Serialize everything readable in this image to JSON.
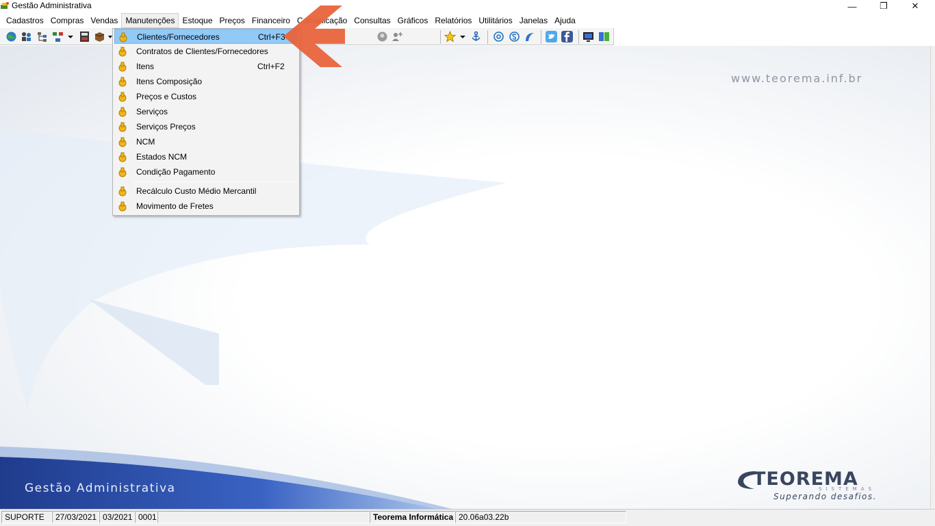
{
  "window": {
    "title": "Gestão Administrativa",
    "controls": {
      "minimize": "—",
      "restore": "❐",
      "close": "✕"
    }
  },
  "menubar": {
    "items": [
      "Cadastros",
      "Compras",
      "Vendas",
      "Manutenções",
      "Estoque",
      "Preços",
      "Financeiro",
      "Comunicação",
      "Consultas",
      "Gráficos",
      "Relatórios",
      "Utilitários",
      "Janelas",
      "Ajuda"
    ],
    "active": "Manutenções"
  },
  "toolbar": {
    "icons": [
      "globe-icon",
      "people-icon",
      "tree-icon",
      "network-icon",
      "chevron-down-icon",
      "calculator-icon",
      "box-icon",
      "chevron-down-icon",
      "user-circle-icon",
      "add-user-icon",
      "star-icon",
      "chevron-down-icon",
      "anchor-icon",
      "email-at-icon",
      "skype-icon",
      "swirl-icon",
      "twitter-icon",
      "facebook-icon",
      "monitor-icon",
      "window-tile-icon"
    ]
  },
  "dropdown": {
    "items": [
      {
        "label": "Clientes/Fornecedores",
        "shortcut": "Ctrl+F3",
        "highlighted": true
      },
      {
        "label": "Contratos de Clientes/Fornecedores",
        "shortcut": ""
      },
      {
        "label": "Itens",
        "shortcut": "Ctrl+F2"
      },
      {
        "label": "Itens Composição",
        "shortcut": ""
      },
      {
        "label": "Preços e Custos",
        "shortcut": ""
      },
      {
        "label": "Serviços",
        "shortcut": ""
      },
      {
        "label": "Serviços Preços",
        "shortcut": ""
      },
      {
        "label": "NCM",
        "shortcut": ""
      },
      {
        "label": "Estados NCM",
        "shortcut": ""
      },
      {
        "label": "Condição Pagamento",
        "shortcut": ""
      },
      {
        "label": "Recálculo Custo Médio Mercantil",
        "shortcut": ""
      },
      {
        "label": "Movimento de Fretes",
        "shortcut": ""
      }
    ]
  },
  "background": {
    "website": "www.teorema.inf.br",
    "product_label": "Gestão Administrativa",
    "logo_brand": "TEOREMA",
    "logo_sub": "SISTEMAS",
    "logo_slogan": "Superando desafios."
  },
  "statusbar": {
    "user": "SUPORTE",
    "date": "27/03/2021",
    "period": "03/2021",
    "code": "0001",
    "empty": "",
    "company": "Teorema Informática",
    "version": "20.06a03.22b"
  },
  "colors": {
    "highlight": "#91c9f7",
    "arrow": "#e8643c",
    "swoosh": "#1f3b8c",
    "menu_icon": "#f2b51c"
  }
}
